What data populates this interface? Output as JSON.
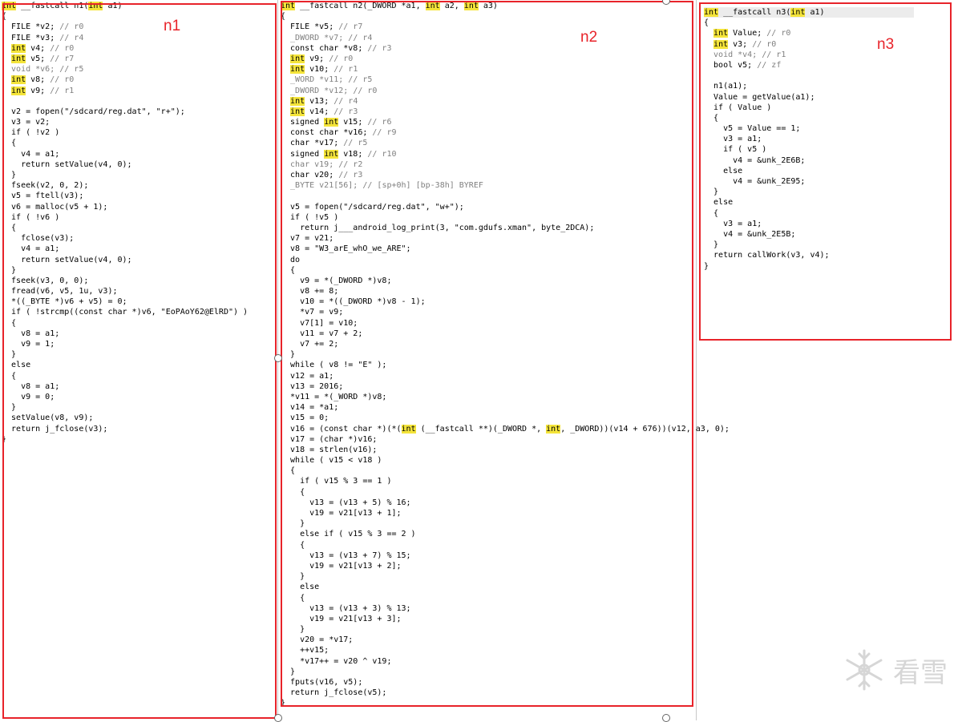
{
  "labels": {
    "n1": "n1",
    "n2": "n2",
    "n3": "n3"
  },
  "watermark": {
    "text": "看雪"
  },
  "panes": {
    "n1": [
      [
        {
          "t": "int",
          "h": 1
        },
        {
          "t": " __fastcall n1("
        },
        {
          "t": "int",
          "h": 1
        },
        {
          "t": " a1)"
        }
      ],
      [
        {
          "t": "{"
        }
      ],
      [
        {
          "t": "  FILE *v2; "
        },
        {
          "t": "// r0",
          "c": "gray"
        }
      ],
      [
        {
          "t": "  FILE *v3; "
        },
        {
          "t": "// r4",
          "c": "gray"
        }
      ],
      [
        {
          "t": "  "
        },
        {
          "t": "int",
          "h": 1
        },
        {
          "t": " v4; "
        },
        {
          "t": "// r0",
          "c": "gray"
        }
      ],
      [
        {
          "t": "  "
        },
        {
          "t": "int",
          "h": 1
        },
        {
          "t": " v5; "
        },
        {
          "t": "// r7",
          "c": "gray"
        }
      ],
      [
        {
          "t": "  void *v6; ",
          "c": "gray"
        },
        {
          "t": "// r5",
          "c": "gray"
        }
      ],
      [
        {
          "t": "  "
        },
        {
          "t": "int",
          "h": 1
        },
        {
          "t": " v8; "
        },
        {
          "t": "// r0",
          "c": "gray"
        }
      ],
      [
        {
          "t": "  "
        },
        {
          "t": "int",
          "h": 1
        },
        {
          "t": " v9; "
        },
        {
          "t": "// r1",
          "c": "gray"
        }
      ],
      [
        {
          "t": ""
        }
      ],
      [
        {
          "t": "  v2 = fopen(\"/sdcard/reg.dat\", \"r+\");"
        }
      ],
      [
        {
          "t": "  v3 = v2;"
        }
      ],
      [
        {
          "t": "  if ( !v2 )"
        }
      ],
      [
        {
          "t": "  {"
        }
      ],
      [
        {
          "t": "    v4 = a1;"
        }
      ],
      [
        {
          "t": "    return setValue(v4, 0);"
        }
      ],
      [
        {
          "t": "  }"
        }
      ],
      [
        {
          "t": "  fseek(v2, 0, 2);"
        }
      ],
      [
        {
          "t": "  v5 = ftell(v3);"
        }
      ],
      [
        {
          "t": "  v6 = malloc(v5 + 1);"
        }
      ],
      [
        {
          "t": "  if ( !v6 )"
        }
      ],
      [
        {
          "t": "  {"
        }
      ],
      [
        {
          "t": "    fclose(v3);"
        }
      ],
      [
        {
          "t": "    v4 = a1;"
        }
      ],
      [
        {
          "t": "    return setValue(v4, 0);"
        }
      ],
      [
        {
          "t": "  }"
        }
      ],
      [
        {
          "t": "  fseek(v3, 0, 0);"
        }
      ],
      [
        {
          "t": "  fread(v6, v5, 1u, v3);"
        }
      ],
      [
        {
          "t": "  *((_BYTE *)v6 + v5) = 0;"
        }
      ],
      [
        {
          "t": "  if ( !strcmp((const char *)v6, \"EoPAoY62@ElRD\") )"
        }
      ],
      [
        {
          "t": "  {"
        }
      ],
      [
        {
          "t": "    v8 = a1;"
        }
      ],
      [
        {
          "t": "    v9 = 1;"
        }
      ],
      [
        {
          "t": "  }"
        }
      ],
      [
        {
          "t": "  else"
        }
      ],
      [
        {
          "t": "  {"
        }
      ],
      [
        {
          "t": "    v8 = a1;"
        }
      ],
      [
        {
          "t": "    v9 = 0;"
        }
      ],
      [
        {
          "t": "  }"
        }
      ],
      [
        {
          "t": "  setValue(v8, v9);"
        }
      ],
      [
        {
          "t": "  return j_fclose(v3);"
        }
      ],
      [
        {
          "t": "}"
        }
      ]
    ],
    "n2": [
      [
        {
          "t": "int",
          "h": 1
        },
        {
          "t": " __fastcall n2(_DWORD *a1, "
        },
        {
          "t": "int",
          "h": 1
        },
        {
          "t": " a2, "
        },
        {
          "t": "int",
          "h": 1
        },
        {
          "t": " a3)"
        }
      ],
      [
        {
          "t": "{"
        }
      ],
      [
        {
          "t": "  FILE *v5; "
        },
        {
          "t": "// r7",
          "c": "gray"
        }
      ],
      [
        {
          "t": "  _DWORD *v7; ",
          "c": "gray"
        },
        {
          "t": "// r4",
          "c": "gray"
        }
      ],
      [
        {
          "t": "  const char *v8; "
        },
        {
          "t": "// r3",
          "c": "gray"
        }
      ],
      [
        {
          "t": "  "
        },
        {
          "t": "int",
          "h": 1
        },
        {
          "t": " v9; "
        },
        {
          "t": "// r0",
          "c": "gray"
        }
      ],
      [
        {
          "t": "  "
        },
        {
          "t": "int",
          "h": 1
        },
        {
          "t": " v10; "
        },
        {
          "t": "// r1",
          "c": "gray"
        }
      ],
      [
        {
          "t": "  _WORD *v11; ",
          "c": "gray"
        },
        {
          "t": "// r5",
          "c": "gray"
        }
      ],
      [
        {
          "t": "  _DWORD *v12; ",
          "c": "gray"
        },
        {
          "t": "// r0",
          "c": "gray"
        }
      ],
      [
        {
          "t": "  "
        },
        {
          "t": "int",
          "h": 1
        },
        {
          "t": " v13; "
        },
        {
          "t": "// r4",
          "c": "gray"
        }
      ],
      [
        {
          "t": "  "
        },
        {
          "t": "int",
          "h": 1
        },
        {
          "t": " v14; "
        },
        {
          "t": "// r3",
          "c": "gray"
        }
      ],
      [
        {
          "t": "  signed "
        },
        {
          "t": "int",
          "h": 1
        },
        {
          "t": " v15; "
        },
        {
          "t": "// r6",
          "c": "gray"
        }
      ],
      [
        {
          "t": "  const char *v16; "
        },
        {
          "t": "// r9",
          "c": "gray"
        }
      ],
      [
        {
          "t": "  char *v17; "
        },
        {
          "t": "// r5",
          "c": "gray"
        }
      ],
      [
        {
          "t": "  signed "
        },
        {
          "t": "int",
          "h": 1
        },
        {
          "t": " v18; "
        },
        {
          "t": "// r10",
          "c": "gray"
        }
      ],
      [
        {
          "t": "  char v19; ",
          "c": "gray"
        },
        {
          "t": "// r2",
          "c": "gray"
        }
      ],
      [
        {
          "t": "  char v20; "
        },
        {
          "t": "// r3",
          "c": "gray"
        }
      ],
      [
        {
          "t": "  _BYTE v21[56]; ",
          "c": "gray"
        },
        {
          "t": "// [sp+0h] [bp-38h] BYREF",
          "c": "gray"
        }
      ],
      [
        {
          "t": ""
        }
      ],
      [
        {
          "t": "  v5 = fopen(\"/sdcard/reg.dat\", \"w+\");"
        }
      ],
      [
        {
          "t": "  if ( !v5 )"
        }
      ],
      [
        {
          "t": "    return j___android_log_print(3, \"com.gdufs.xman\", byte_2DCA);"
        }
      ],
      [
        {
          "t": "  v7 = v21;"
        }
      ],
      [
        {
          "t": "  v8 = \"W3_arE_whO_we_ARE\";"
        }
      ],
      [
        {
          "t": "  do"
        }
      ],
      [
        {
          "t": "  {"
        }
      ],
      [
        {
          "t": "    v9 = *(_DWORD *)v8;"
        }
      ],
      [
        {
          "t": "    v8 += 8;"
        }
      ],
      [
        {
          "t": "    v10 = *((_DWORD *)v8 - 1);"
        }
      ],
      [
        {
          "t": "    *v7 = v9;"
        }
      ],
      [
        {
          "t": "    v7[1] = v10;"
        }
      ],
      [
        {
          "t": "    v11 = v7 + 2;"
        }
      ],
      [
        {
          "t": "    v7 += 2;"
        }
      ],
      [
        {
          "t": "  }"
        }
      ],
      [
        {
          "t": "  while ( v8 != \"E\" );"
        }
      ],
      [
        {
          "t": "  v12 = a1;"
        }
      ],
      [
        {
          "t": "  v13 = 2016;"
        }
      ],
      [
        {
          "t": "  *v11 = *(_WORD *)v8;"
        }
      ],
      [
        {
          "t": "  v14 = *a1;"
        }
      ],
      [
        {
          "t": "  v15 = 0;"
        }
      ],
      [
        {
          "t": "  v16 = (const char *)(*("
        },
        {
          "t": "int",
          "h": 1
        },
        {
          "t": " (__fastcall **)(_DWORD *, "
        },
        {
          "t": "int",
          "h": 1
        },
        {
          "t": ", _DWORD))(v14 + 676))(v12, a3, 0);"
        }
      ],
      [
        {
          "t": "  v17 = (char *)v16;"
        }
      ],
      [
        {
          "t": "  v18 = strlen(v16);"
        }
      ],
      [
        {
          "t": "  while ( v15 < v18 )"
        }
      ],
      [
        {
          "t": "  {"
        }
      ],
      [
        {
          "t": "    if ( v15 % 3 == 1 )"
        }
      ],
      [
        {
          "t": "    {"
        }
      ],
      [
        {
          "t": "      v13 = (v13 + 5) % 16;"
        }
      ],
      [
        {
          "t": "      v19 = v21[v13 + 1];"
        }
      ],
      [
        {
          "t": "    }"
        }
      ],
      [
        {
          "t": "    else if ( v15 % 3 == 2 )"
        }
      ],
      [
        {
          "t": "    {"
        }
      ],
      [
        {
          "t": "      v13 = (v13 + 7) % 15;"
        }
      ],
      [
        {
          "t": "      v19 = v21[v13 + 2];"
        }
      ],
      [
        {
          "t": "    }"
        }
      ],
      [
        {
          "t": "    else"
        }
      ],
      [
        {
          "t": "    {"
        }
      ],
      [
        {
          "t": "      v13 = (v13 + 3) % 13;"
        }
      ],
      [
        {
          "t": "      v19 = v21[v13 + 3];"
        }
      ],
      [
        {
          "t": "    }"
        }
      ],
      [
        {
          "t": "    v20 = *v17;"
        }
      ],
      [
        {
          "t": "    ++v15;"
        }
      ],
      [
        {
          "t": "    *v17++ = v20 ^ v19;"
        }
      ],
      [
        {
          "t": "  }"
        }
      ],
      [
        {
          "t": "  fputs(v16, v5);"
        }
      ],
      [
        {
          "t": "  return j_fclose(v5);"
        }
      ],
      [
        {
          "t": "}"
        }
      ]
    ],
    "n3": [
      [
        {
          "t": "int",
          "h": 1
        },
        {
          "t": " __fastcall n3("
        },
        {
          "t": "int",
          "h": 1
        },
        {
          "t": " a1)"
        }
      ],
      [
        {
          "t": "{"
        }
      ],
      [
        {
          "t": "  "
        },
        {
          "t": "int",
          "h": 1
        },
        {
          "t": " Value; "
        },
        {
          "t": "// r0",
          "c": "gray"
        }
      ],
      [
        {
          "t": "  "
        },
        {
          "t": "int",
          "h": 1
        },
        {
          "t": " v3; "
        },
        {
          "t": "// r0",
          "c": "gray"
        }
      ],
      [
        {
          "t": "  void *v4; ",
          "c": "gray"
        },
        {
          "t": "// r1",
          "c": "gray"
        }
      ],
      [
        {
          "t": "  bool v5; "
        },
        {
          "t": "// zf",
          "c": "gray"
        }
      ],
      [
        {
          "t": ""
        }
      ],
      [
        {
          "t": "  n1(a1);"
        }
      ],
      [
        {
          "t": "  Value = getValue(a1);"
        }
      ],
      [
        {
          "t": "  if ( Value )"
        }
      ],
      [
        {
          "t": "  {"
        }
      ],
      [
        {
          "t": "    v5 = Value == 1;"
        }
      ],
      [
        {
          "t": "    v3 = a1;"
        }
      ],
      [
        {
          "t": "    if ( v5 )"
        }
      ],
      [
        {
          "t": "      v4 = &unk_2E6B;"
        }
      ],
      [
        {
          "t": "    else"
        }
      ],
      [
        {
          "t": "      v4 = &unk_2E95;"
        }
      ],
      [
        {
          "t": "  }"
        }
      ],
      [
        {
          "t": "  else"
        }
      ],
      [
        {
          "t": "  {"
        }
      ],
      [
        {
          "t": "    v3 = a1;"
        }
      ],
      [
        {
          "t": "    v4 = &unk_2E5B;"
        }
      ],
      [
        {
          "t": "  }"
        }
      ],
      [
        {
          "t": "  return callWork(v3, v4);"
        }
      ],
      [
        {
          "t": "}"
        }
      ]
    ]
  }
}
